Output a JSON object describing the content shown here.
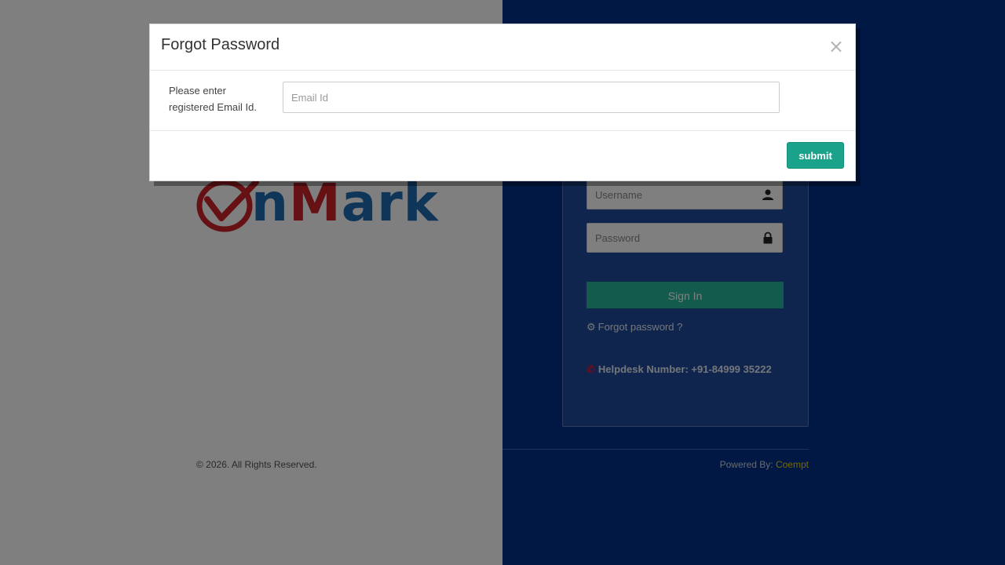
{
  "brand": {
    "logo_n": "n",
    "logo_m": "M",
    "logo_ark": "ark"
  },
  "footer": {
    "copyright": "© 2026. All Rights Reserved.",
    "powered_label": "Powered By: ",
    "powered_brand": "Coempt"
  },
  "login": {
    "username_placeholder": "Username",
    "password_placeholder": "Password",
    "signin_label": "Sign In",
    "forgot_label": "Forgot password ?",
    "helpdesk_text": "Helpdesk Number: +91-84999 35222"
  },
  "modal": {
    "title": "Forgot Password",
    "close_label": "×",
    "prompt": "Please enter registered Email Id.",
    "email_placeholder": "Email Id",
    "submit_label": "submit"
  },
  "colors": {
    "right_pane": "#003087",
    "accent": "#1aa38a",
    "brand_blue": "#1f6bb0",
    "brand_red": "#cc2229",
    "powered_brand": "#f2d100"
  },
  "icons": {
    "username": "user-icon",
    "password": "lock-icon",
    "forgot": "gear-icon",
    "helpdesk": "phone-icon",
    "logo_mark": "checkmark-icon"
  }
}
